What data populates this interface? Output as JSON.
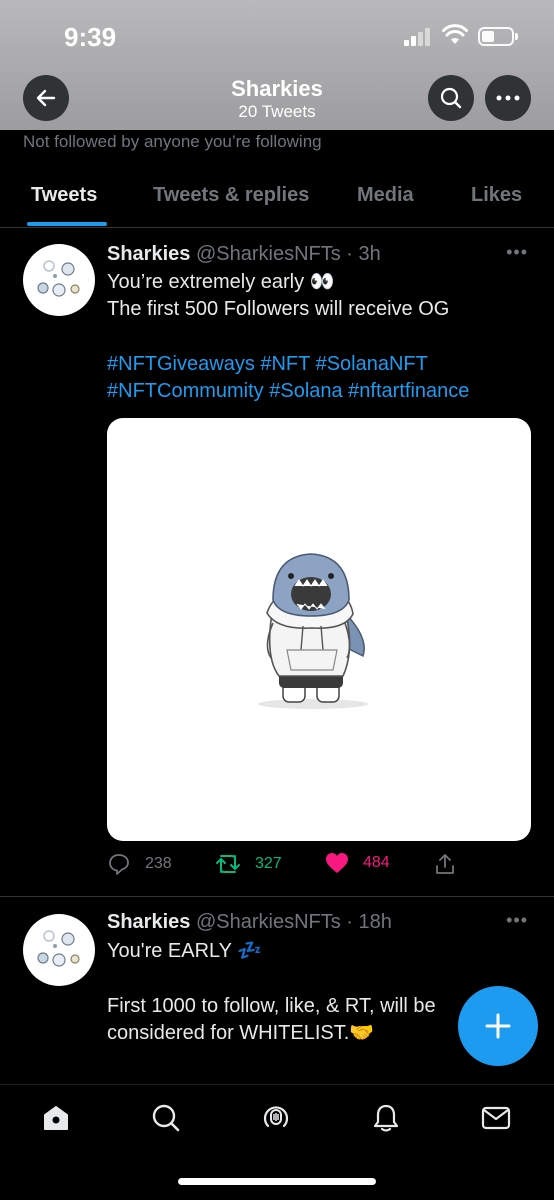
{
  "status": {
    "time": "9:39"
  },
  "profile": {
    "name": "Sharkies",
    "tweet_count": "20 Tweets",
    "follow_note": "Not followed by anyone you’re following"
  },
  "tabs": [
    {
      "label": "Tweets",
      "active": true
    },
    {
      "label": "Tweets & replies",
      "active": false
    },
    {
      "label": "Media",
      "active": false
    },
    {
      "label": "Likes",
      "active": false
    }
  ],
  "tweets": [
    {
      "name": "Sharkies",
      "handle": "@SharkiesNFTs",
      "time": "· 3h",
      "line1": "You’re extremely early 👀",
      "line2": "The first 500 Followers will receive OG",
      "hashtags_line1": "#NFTGiveaways #NFT  #SolanaNFT",
      "hashtags_line2": "#NFTCommumity #Solana #nftartfinance",
      "replies": "238",
      "retweets": "327",
      "likes": "484"
    },
    {
      "name": "Sharkies",
      "handle": "@SharkiesNFTs",
      "time": "· 18h",
      "line1": "You're EARLY 💤",
      "line2": "First 1000 to follow, like, & RT, will be",
      "line3": "considered for WHITELIST.🤝"
    }
  ],
  "colors": {
    "accent": "#1d9bf0",
    "like": "#f91880",
    "retweet": "#00ba7c",
    "muted": "#71767b"
  },
  "icons": [
    "back-arrow-icon",
    "search-icon",
    "more-icon",
    "reply-icon",
    "retweet-icon",
    "heart-icon",
    "share-icon",
    "compose-icon",
    "home-icon",
    "explore-icon",
    "spaces-icon",
    "notifications-icon",
    "messages-icon"
  ]
}
